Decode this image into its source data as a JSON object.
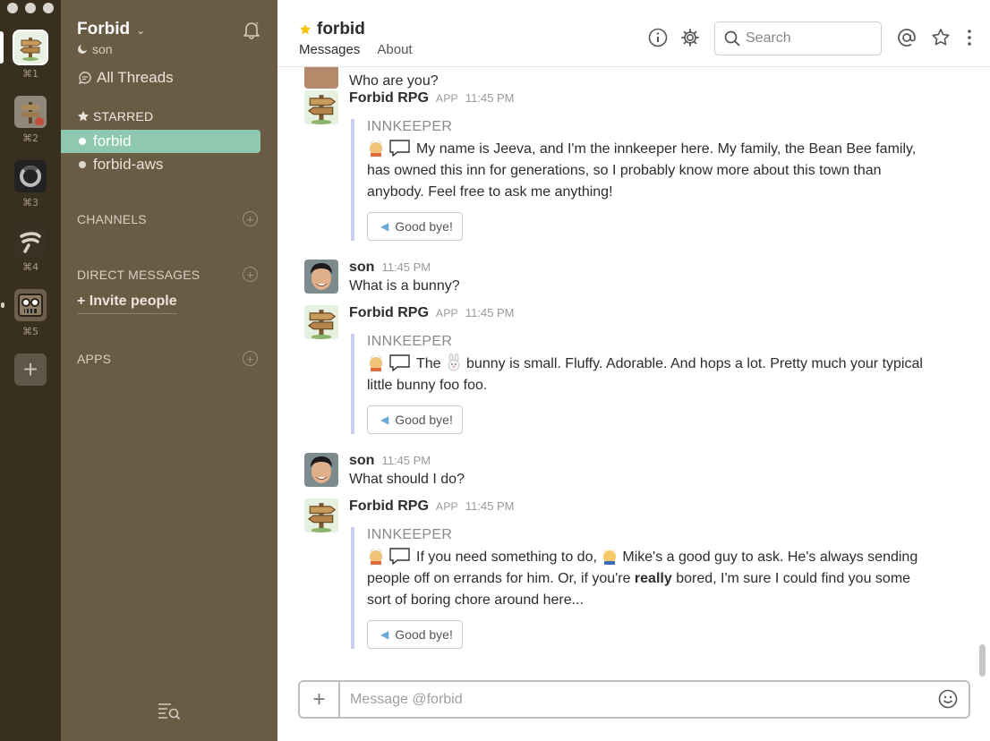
{
  "workspaces": [
    {
      "key": "⌘1"
    },
    {
      "key": "⌘2"
    },
    {
      "key": "⌘3"
    },
    {
      "key": "⌘4"
    },
    {
      "key": "⌘5"
    }
  ],
  "sidebar": {
    "team_name": "Forbid",
    "user_name": "son",
    "all_threads": "All Threads",
    "starred_label": "STARRED",
    "starred_channels": [
      "forbid",
      "forbid-aws"
    ],
    "channels_label": "CHANNELS",
    "dm_label": "DIRECT MESSAGES",
    "invite_label": "+ Invite people",
    "apps_label": "APPS"
  },
  "header": {
    "channel": "forbid",
    "tabs": [
      "Messages",
      "About"
    ],
    "search_placeholder": "Search"
  },
  "messages": [
    {
      "text": "Who are you?"
    },
    {
      "author": "Forbid RPG",
      "badge": "APP",
      "time": "11:45 PM",
      "att_title": "INNKEEPER",
      "body": "My name is Jeeva, and I'm the innkeeper here.  My family, the Bean Bee family, has owned this inn for generations, so I probably know more about this town than anybody.  Feel free to ask me anything!",
      "button": "Good bye!"
    },
    {
      "author": "son",
      "time": "11:45 PM",
      "text": "What is a bunny?"
    },
    {
      "author": "Forbid RPG",
      "badge": "APP",
      "time": "11:45 PM",
      "att_title": "INNKEEPER",
      "body_pre": "The",
      "body_post": "bunny is small.  Fluffy.  Adorable.  And hops a lot.  Pretty much your typical little bunny foo foo.",
      "button": "Good bye!"
    },
    {
      "author": "son",
      "time": "11:45 PM",
      "text": "What should I do?"
    },
    {
      "author": "Forbid RPG",
      "badge": "APP",
      "time": "11:45 PM",
      "att_title": "INNKEEPER",
      "body_a": "If you need something to do,",
      "body_b": "Mike's a good guy to ask.  He's always sending people off on errands for him.  Or, if you're",
      "body_bold": "really",
      "body_c": "bored, I'm sure I could find you some sort of boring chore around here...",
      "button": "Good bye!"
    }
  ],
  "composer": {
    "placeholder": "Message @forbid"
  },
  "colors": {
    "rail": "#392f1f",
    "sidebar": "#6a5b45",
    "selected": "#8fc8b0",
    "attachment_border": "#ccd0f0"
  }
}
